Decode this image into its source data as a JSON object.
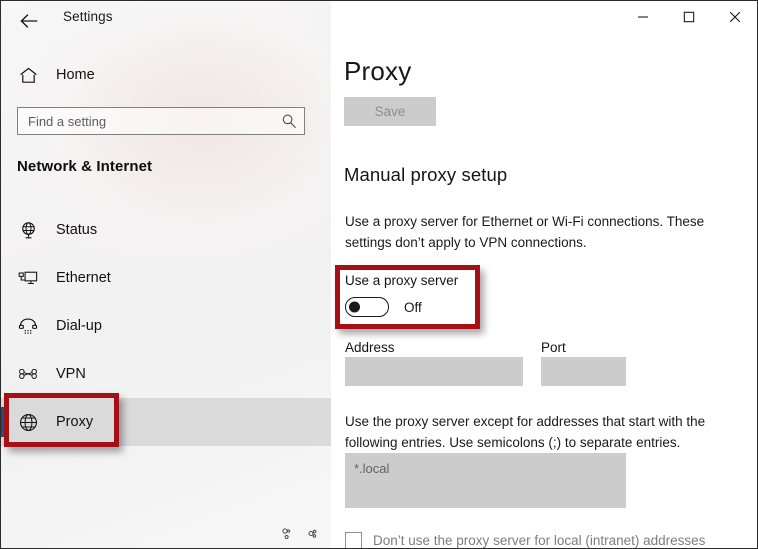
{
  "window": {
    "titlebar_label": "Settings",
    "back_icon": "back-arrow-icon",
    "controls": [
      {
        "name": "minimize",
        "glyph": "minimize-icon"
      },
      {
        "name": "maximize",
        "glyph": "maximize-icon"
      },
      {
        "name": "close",
        "glyph": "close-icon"
      }
    ]
  },
  "sidebar": {
    "home_label": "Home",
    "home_icon": "home-icon",
    "search": {
      "placeholder": "Find a setting",
      "value": "",
      "icon": "search-icon"
    },
    "section_header": "Network & Internet",
    "items": [
      {
        "label": "Status",
        "icon": "globe-stand-icon",
        "selected": false
      },
      {
        "label": "Ethernet",
        "icon": "ethernet-icon",
        "selected": false
      },
      {
        "label": "Dial-up",
        "icon": "phone-handset-icon",
        "selected": false
      },
      {
        "label": "VPN",
        "icon": "vpn-key-icon",
        "selected": false
      },
      {
        "label": "Proxy",
        "icon": "globe-icon",
        "selected": true
      }
    ]
  },
  "main": {
    "page_title": "Proxy",
    "save_label": "Save",
    "save_disabled": true,
    "section_title": "Manual proxy setup",
    "description": "Use a proxy server for Ethernet or Wi-Fi connections. These settings don’t apply to VPN connections.",
    "proxy_toggle": {
      "label": "Use a proxy server",
      "state": "Off",
      "checked": false
    },
    "address": {
      "label": "Address",
      "value": "",
      "placeholder": ""
    },
    "port": {
      "label": "Port",
      "value": "",
      "placeholder": ""
    },
    "exceptions_description": "Use the proxy server except for addresses that start with the following entries. Use semicolons (;) to separate entries.",
    "exceptions": {
      "placeholder": "*.local",
      "value": ""
    },
    "intranet_checkbox": {
      "label": "Don’t use the proxy server for local (intranet) addresses",
      "checked": false
    }
  },
  "annotations": {
    "highlight_color": "#a50f17",
    "boxes": [
      {
        "name": "proxy-nav-highlight",
        "target": "sidebar-item-proxy"
      },
      {
        "name": "proxy-toggle-highlight",
        "target": "use-proxy-server-toggle"
      }
    ]
  },
  "theme": {
    "accent": "#2b4a86",
    "selected_row_bg": "#dadada",
    "field_bg": "#cccccc",
    "disabled_text": "#8d8d8d"
  }
}
